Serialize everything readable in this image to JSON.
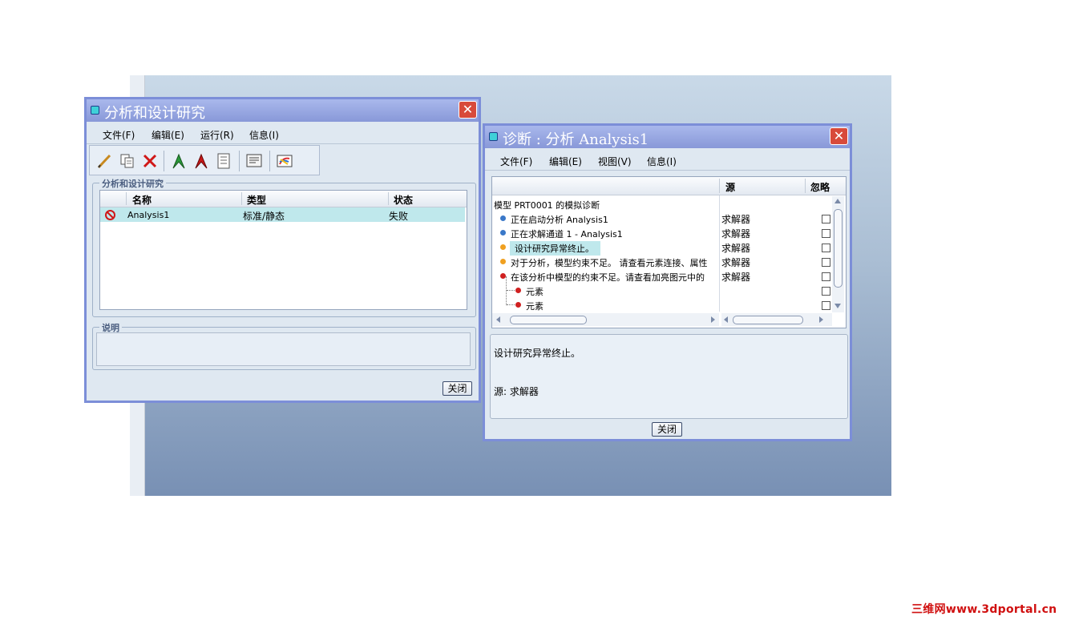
{
  "watermark": "三维网www.3dportal.cn",
  "left_dialog": {
    "title": "分析和设计研究",
    "menu": [
      "文件(F)",
      "编辑(E)",
      "运行(R)",
      "信息(I)"
    ],
    "group_label": "分析和设计研究",
    "columns": [
      "名称",
      "类型",
      "状态"
    ],
    "rows": [
      {
        "name": "Analysis1",
        "type": "标准/静态",
        "status": "失败"
      }
    ],
    "desc_label": "说明",
    "close_label": "关闭"
  },
  "right_dialog": {
    "title": "诊断 : 分析 Analysis1",
    "menu": [
      "文件(F)",
      "编辑(E)",
      "视图(V)",
      "信息(I)"
    ],
    "columns": {
      "source": "源",
      "ignore": "忽略"
    },
    "tree": [
      {
        "text": "模型 PRT0001 的模拟诊断",
        "source": "",
        "level": 0,
        "dot": ""
      },
      {
        "text": "正在启动分析 Analysis1",
        "source": "求解器",
        "level": 1,
        "dot": "#3a78c8"
      },
      {
        "text": "正在求解通道 1 - Analysis1",
        "source": "求解器",
        "level": 1,
        "dot": "#3a78c8"
      },
      {
        "text": "设计研究异常终止。",
        "source": "求解器",
        "level": 1,
        "dot": "#f0a020",
        "selected": true
      },
      {
        "text": "对于分析，模型约束不足。 请查看元素连接、属性",
        "source": "求解器",
        "level": 1,
        "dot": "#f0a020"
      },
      {
        "text": "在该分析中模型的约束不足。请查看加亮图元中的",
        "source": "求解器",
        "level": 1,
        "dot": "#d02020"
      },
      {
        "text": "元素",
        "source": "",
        "level": 2,
        "dot": "#d02020"
      },
      {
        "text": "元素",
        "source": "",
        "level": 2,
        "dot": "#d02020"
      }
    ],
    "detail": {
      "message": "设计研究异常终止。",
      "source_line": "源: 求解器"
    },
    "close_label": "关闭"
  }
}
